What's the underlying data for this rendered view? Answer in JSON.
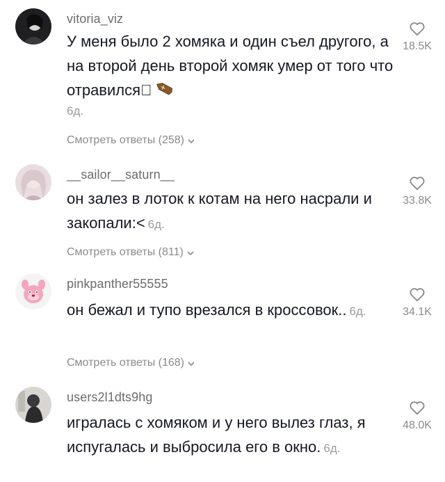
{
  "comments": [
    {
      "username": "vitoria_viz",
      "text": "У меня было 2 хомяка и один съел другого, а на второй день второй хомяк умер от того что отравился",
      "emoji_box": "⃞",
      "ago": "6д.",
      "replies": "Смотреть ответы (258)",
      "likes": "18.5K"
    },
    {
      "username": "__sailor__saturn__",
      "text": "он залез в лоток к котам на него насрали и закопали:<",
      "ago": "6д.",
      "replies": "Смотреть ответы (811)",
      "likes": "33.8K"
    },
    {
      "username": "pinkpanther55555",
      "text": "он бежал и тупо врезался в кроссовок..",
      "ago": "6д.",
      "replies": "Смотреть ответы (168)",
      "likes": "34.1K"
    },
    {
      "username": "users2l1dts9hg",
      "text": "игралась с хомяком и у него вылез глаз, я испугалась и выбросила его в окно.",
      "ago": "6д.",
      "likes": "48.0K"
    }
  ],
  "icons": {
    "like": "heart-outline-icon",
    "expand": "chevron-down-icon",
    "emoji": "coffin-icon"
  }
}
